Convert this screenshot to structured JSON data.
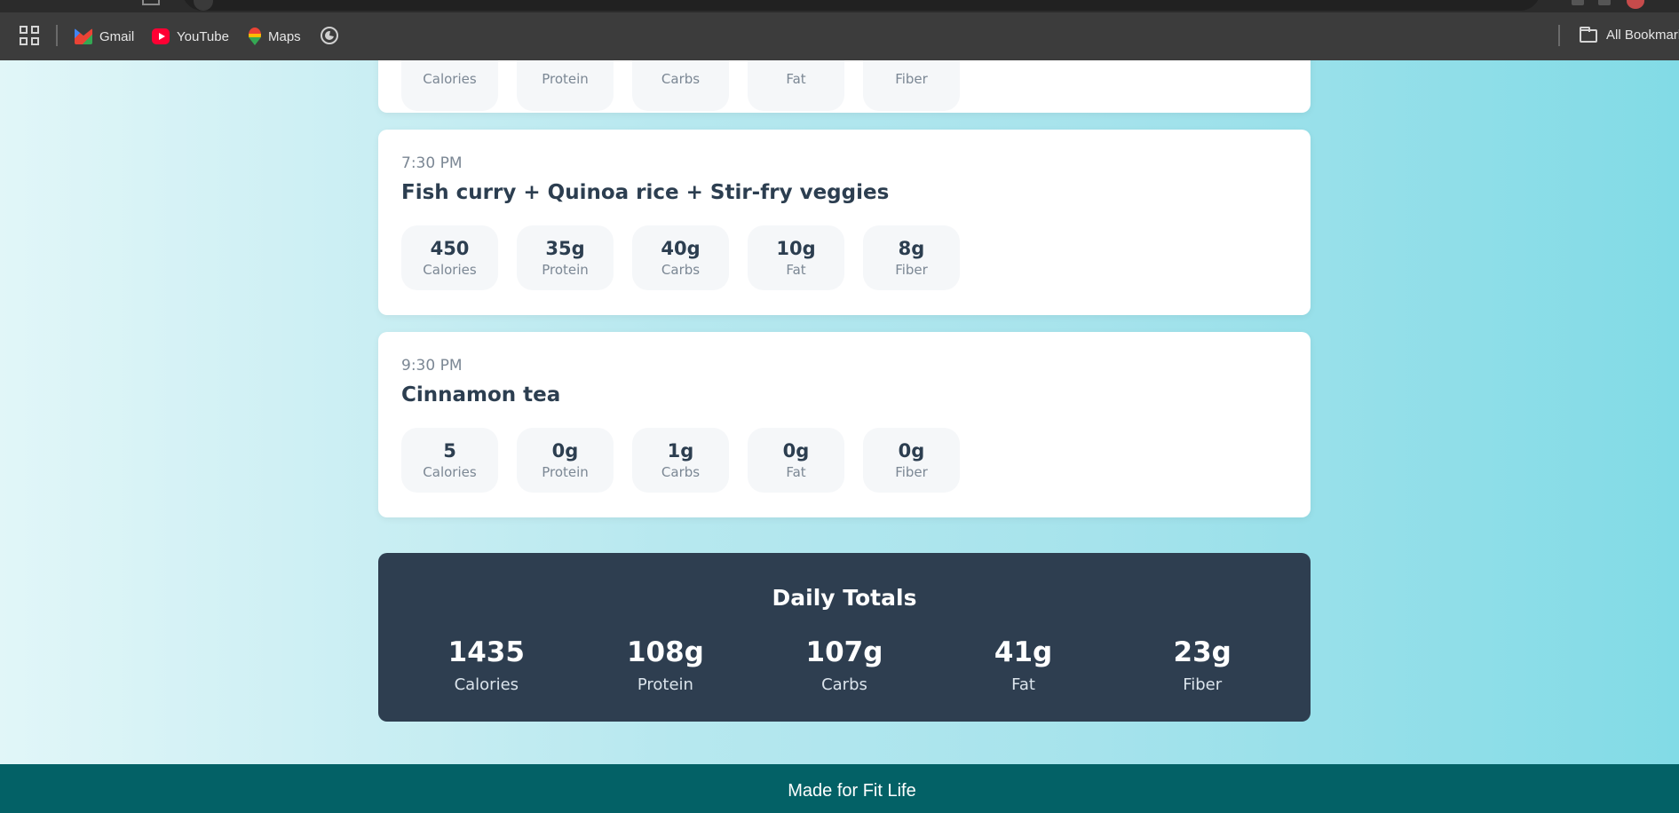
{
  "browser": {
    "bookmarks": [
      {
        "label": "Gmail",
        "icon": "gmail-icon"
      },
      {
        "label": "YouTube",
        "icon": "youtube-icon"
      },
      {
        "label": "Maps",
        "icon": "maps-icon"
      }
    ],
    "all_bookmarks_label": "All Bookmarks"
  },
  "meals": [
    {
      "time": "",
      "title": "",
      "nutrients": [
        {
          "value": "",
          "label": "Calories"
        },
        {
          "value": "",
          "label": "Protein"
        },
        {
          "value": "",
          "label": "Carbs"
        },
        {
          "value": "",
          "label": "Fat"
        },
        {
          "value": "",
          "label": "Fiber"
        }
      ]
    },
    {
      "time": "7:30 PM",
      "title": "Fish curry + Quinoa rice + Stir-fry veggies",
      "nutrients": [
        {
          "value": "450",
          "label": "Calories"
        },
        {
          "value": "35g",
          "label": "Protein"
        },
        {
          "value": "40g",
          "label": "Carbs"
        },
        {
          "value": "10g",
          "label": "Fat"
        },
        {
          "value": "8g",
          "label": "Fiber"
        }
      ]
    },
    {
      "time": "9:30 PM",
      "title": "Cinnamon tea",
      "nutrients": [
        {
          "value": "5",
          "label": "Calories"
        },
        {
          "value": "0g",
          "label": "Protein"
        },
        {
          "value": "1g",
          "label": "Carbs"
        },
        {
          "value": "0g",
          "label": "Fat"
        },
        {
          "value": "0g",
          "label": "Fiber"
        }
      ]
    }
  ],
  "totals": {
    "title": "Daily Totals",
    "items": [
      {
        "value": "1435",
        "label": "Calories"
      },
      {
        "value": "108g",
        "label": "Protein"
      },
      {
        "value": "107g",
        "label": "Carbs"
      },
      {
        "value": "41g",
        "label": "Fat"
      },
      {
        "value": "23g",
        "label": "Fiber"
      }
    ]
  },
  "footer": {
    "text": "Made for Fit Life"
  },
  "colors": {
    "card_text": "#2c3e50",
    "muted": "#7b8794",
    "totals_bg": "#2e3e50",
    "footer_bg": "#036166"
  }
}
